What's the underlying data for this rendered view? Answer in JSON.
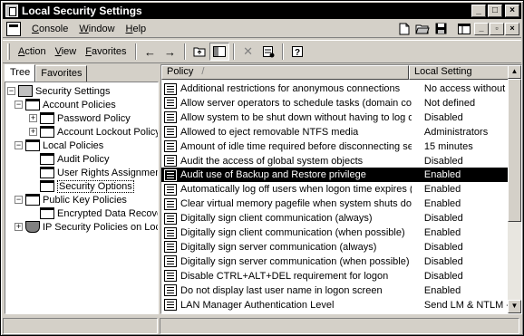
{
  "window": {
    "title": "Local Security Settings",
    "controls": {
      "minimize": "_",
      "maximize": "□",
      "close": "×"
    },
    "mdi_controls": {
      "minimize": "_",
      "restore": "▫",
      "close": "×"
    }
  },
  "menubar": {
    "items": [
      {
        "label": "Console",
        "access_key": "C"
      },
      {
        "label": "Window",
        "access_key": "W"
      },
      {
        "label": "Help",
        "access_key": "H"
      }
    ],
    "icons": [
      "new-document-icon",
      "open-folder-icon",
      "save-disk-icon",
      "new-window-icon"
    ]
  },
  "toolbar": {
    "menus": [
      {
        "label": "Action",
        "access_key": "A"
      },
      {
        "label": "View",
        "access_key": "V"
      },
      {
        "label": "Favorites",
        "access_key": "F"
      }
    ],
    "buttons": {
      "back": "←",
      "forward": "→",
      "up_level": "⌂",
      "show_hide_tree": "▥",
      "delete": "✕",
      "properties": "▤",
      "help": "?"
    }
  },
  "tabs": [
    {
      "label": "Tree",
      "active": true
    },
    {
      "label": "Favorites",
      "active": false
    }
  ],
  "tree": {
    "items": [
      {
        "label": "Security Settings",
        "expander": "−",
        "icon": "computer-icon"
      },
      {
        "label": "Account Policies",
        "expander": "−",
        "icon": "folder-icon"
      },
      {
        "label": "Password Policy",
        "expander": "+",
        "icon": "folder-icon"
      },
      {
        "label": "Account Lockout Policy",
        "expander": "+",
        "icon": "folder-icon"
      },
      {
        "label": "Local Policies",
        "expander": "−",
        "icon": "folder-icon"
      },
      {
        "label": "Audit Policy",
        "expander": "",
        "icon": "folder-icon"
      },
      {
        "label": "User Rights Assignment",
        "expander": "",
        "icon": "folder-icon"
      },
      {
        "label": "Security Options",
        "expander": "",
        "icon": "folder-icon",
        "selected": true
      },
      {
        "label": "Public Key Policies",
        "expander": "−",
        "icon": "folder-icon"
      },
      {
        "label": "Encrypted Data Recovery",
        "expander": "",
        "icon": "folder-icon"
      },
      {
        "label": "IP Security Policies on Loca M",
        "expander": "+",
        "icon": "shield-icon"
      }
    ]
  },
  "list": {
    "columns": {
      "policy": "Policy",
      "policy_sort": "/",
      "setting": "Local Setting"
    },
    "rows": [
      {
        "policy": "Additional restrictions for anonymous connections",
        "setting": "No access without s..."
      },
      {
        "policy": "Allow server operators to schedule tasks (domain control...",
        "setting": "Not defined"
      },
      {
        "policy": "Allow system to be shut down without having to log on",
        "setting": "Disabled"
      },
      {
        "policy": "Allowed to eject removable NTFS media",
        "setting": "Administrators"
      },
      {
        "policy": "Amount of idle time required before disconnecting session",
        "setting": "15 minutes"
      },
      {
        "policy": "Audit the access of global system objects",
        "setting": "Disabled"
      },
      {
        "policy": "Audit use of Backup and Restore privilege",
        "setting": "Enabled",
        "selected": true
      },
      {
        "policy": "Automatically log off users when logon time expires (local)",
        "setting": "Enabled"
      },
      {
        "policy": "Clear virtual memory pagefile when system shuts down",
        "setting": "Enabled"
      },
      {
        "policy": "Digitally sign client communication (always)",
        "setting": "Disabled"
      },
      {
        "policy": "Digitally sign client communication (when possible)",
        "setting": "Enabled"
      },
      {
        "policy": "Digitally sign server communication (always)",
        "setting": "Disabled"
      },
      {
        "policy": "Digitally sign server communication (when possible)",
        "setting": "Disabled"
      },
      {
        "policy": "Disable CTRL+ALT+DEL requirement for logon",
        "setting": "Disabled"
      },
      {
        "policy": "Do not display last user name in logon screen",
        "setting": "Enabled"
      },
      {
        "policy": "LAN Manager Authentication Level",
        "setting": "Send LM & NTLM -..."
      }
    ]
  },
  "scrollbar": {
    "up": "▲",
    "down": "▼"
  }
}
